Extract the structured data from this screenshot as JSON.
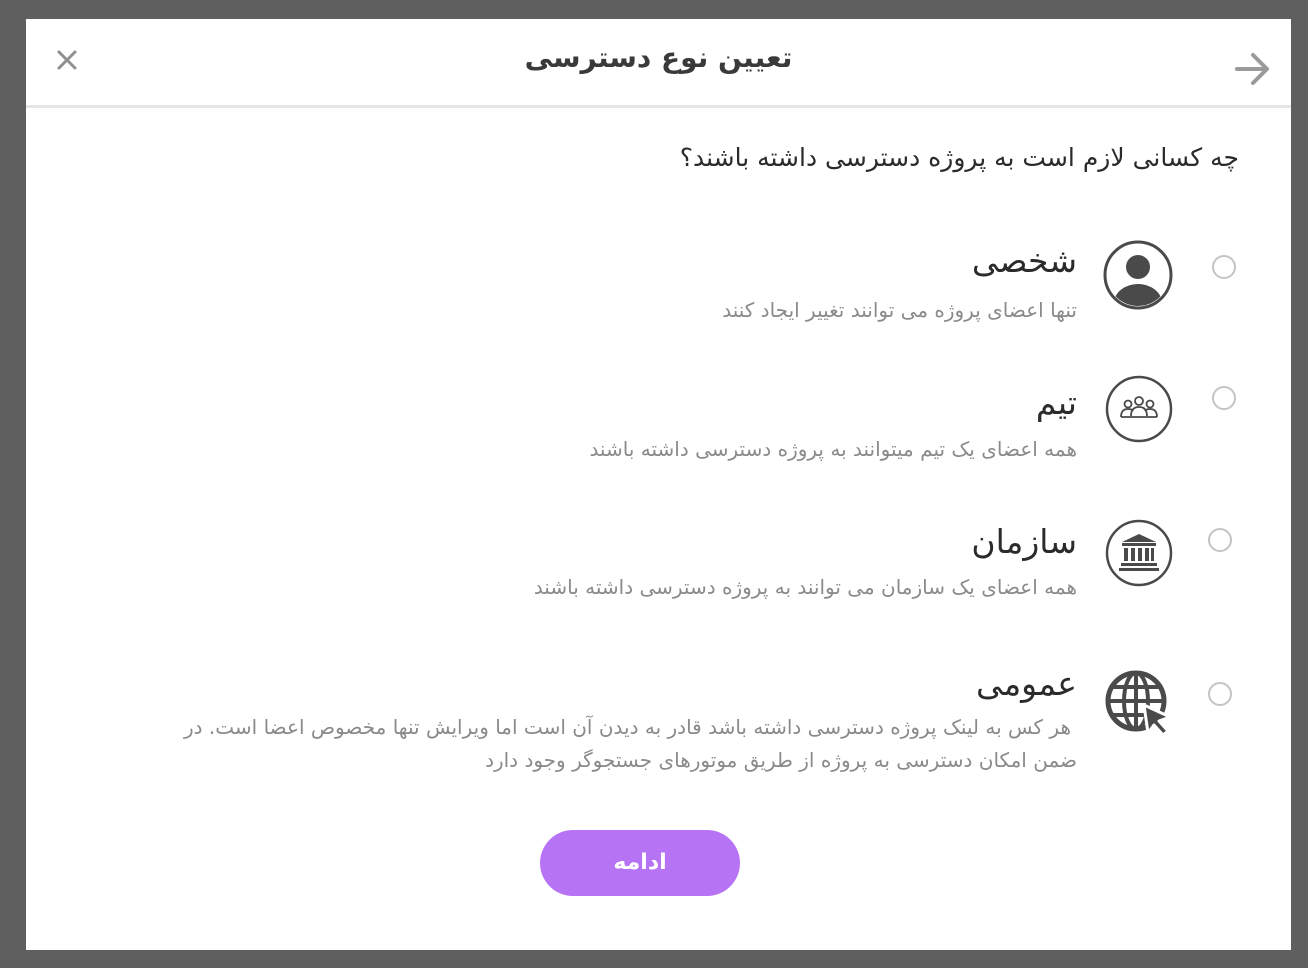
{
  "dialog": {
    "title": "تعیین نوع دسترسی",
    "close_icon": "close-icon",
    "back_icon": "arrow-right-icon"
  },
  "question": "چه کسانی لازم است به پروژه دسترسی داشته باشند؟",
  "options": [
    {
      "title": "شخصی",
      "description": "تنها اعضای پروژه می توانند تغییر ایجاد کنند",
      "icon": "person-icon",
      "selected": false
    },
    {
      "title": "تیم",
      "description": "همه اعضای یک تیم میتوانند به پروژه دسترسی داشته باشند",
      "icon": "team-icon",
      "selected": false
    },
    {
      "title": "سازمان",
      "description": "همه اعضای یک سازمان می توانند به پروژه دسترسی داشته باشند",
      "icon": "institution-icon",
      "selected": false
    },
    {
      "title": "عمومی",
      "description_line1": "هر کس به لینک پروژه دسترسی داشته باشد قادر به دیدن آن است اما ویرایش تنها مخصوص اعضا است. در",
      "description_line2": "ضمن امکان دسترسی به پروژه از طریق موتورهای جستجوگر وجود دارد",
      "icon": "globe-cursor-icon",
      "selected": false
    }
  ],
  "continue_label": "ادامه",
  "colors": {
    "accent": "#b674f5",
    "icon": "#4a4a4a",
    "radio_border": "#c4c4c4",
    "description": "#8a8a8a"
  }
}
